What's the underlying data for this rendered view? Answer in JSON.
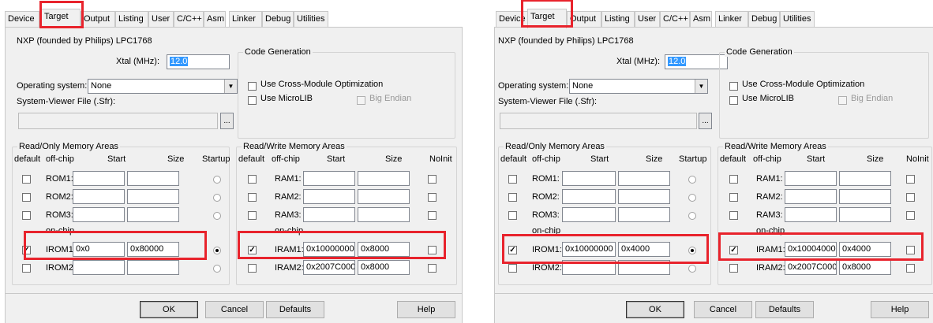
{
  "tabs": [
    "Device",
    "Target",
    "Output",
    "Listing",
    "User",
    "C/C++",
    "Asm",
    "Linker",
    "Debug",
    "Utilities"
  ],
  "device_name": "NXP (founded by Philips) LPC1768",
  "xtal_label": "Xtal (MHz):",
  "xtal_value": "12.0",
  "os_label": "Operating system:",
  "os_value": "None",
  "sfr_label": "System-Viewer File (.Sfr):",
  "browse_label": "...",
  "code_gen": {
    "title": "Code Generation",
    "cross_module": "Use Cross-Module Optimization",
    "microlib": "Use MicroLIB",
    "big_endian": "Big Endian"
  },
  "ro_area": {
    "title": "Read/Only Memory Areas",
    "headers": [
      "default",
      "off-chip",
      "Start",
      "Size",
      "Startup"
    ],
    "rows": [
      "ROM1:",
      "ROM2:",
      "ROM3:"
    ],
    "onchip_label": "on-chip",
    "irom": [
      "IROM1:",
      "IROM2:"
    ]
  },
  "rw_area": {
    "title": "Read/Write Memory Areas",
    "headers": [
      "default",
      "off-chip",
      "Start",
      "Size",
      "NoInit"
    ],
    "rows": [
      "RAM1:",
      "RAM2:",
      "RAM3:"
    ],
    "onchip_label": "on-chip",
    "iram": [
      "IRAM1:",
      "IRAM2:"
    ]
  },
  "buttons": {
    "ok": "OK",
    "cancel": "Cancel",
    "defaults": "Defaults",
    "help": "Help"
  },
  "left": {
    "irom1_start": "0x0",
    "irom1_size": "0x80000",
    "iram1_start": "0x10000000",
    "iram1_size": "0x8000",
    "iram2_start": "0x2007C000",
    "iram2_size": "0x8000"
  },
  "right": {
    "irom1_start": "0x10000000",
    "irom1_size": "0x4000",
    "iram1_start": "0x10004000",
    "iram1_size": "0x4000",
    "iram2_start": "0x2007C000",
    "iram2_size": "0x8000"
  },
  "colors": {
    "highlight": "#e8232c",
    "dialog_bg": "#f0f0f0",
    "selection": "#3399ff"
  }
}
